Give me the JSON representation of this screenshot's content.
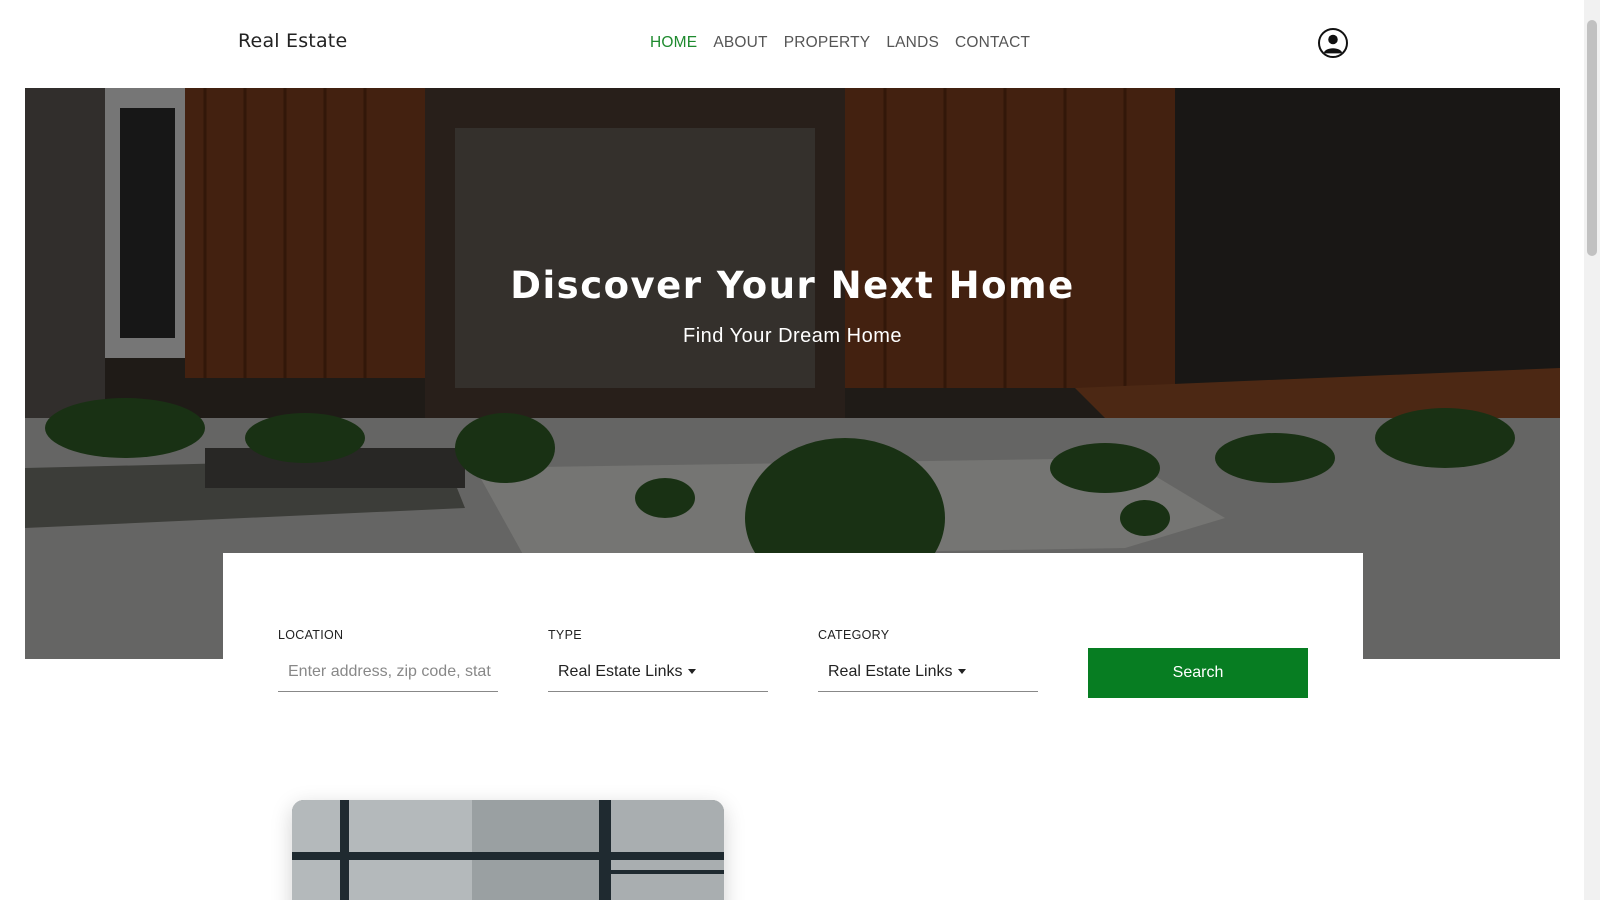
{
  "header": {
    "brand": "Real Estate",
    "nav": [
      {
        "label": "HOME",
        "active": true
      },
      {
        "label": "ABOUT",
        "active": false
      },
      {
        "label": "PROPERTY",
        "active": false
      },
      {
        "label": "LANDS",
        "active": false
      },
      {
        "label": "CONTACT",
        "active": false
      }
    ],
    "user_icon": "user-circle-icon"
  },
  "hero": {
    "title": "Discover Your Next Home",
    "subtitle": "Find Your Dream Home"
  },
  "search": {
    "location": {
      "label": "LOCATION",
      "placeholder": "Enter address, zip code, stat",
      "value": ""
    },
    "type": {
      "label": "TYPE",
      "selected": "Real Estate Links"
    },
    "category": {
      "label": "CATEGORY",
      "selected": "Real Estate Links"
    },
    "button_label": "Search"
  },
  "colors": {
    "accent": "#077d22",
    "nav_active": "#1e8a2e"
  }
}
